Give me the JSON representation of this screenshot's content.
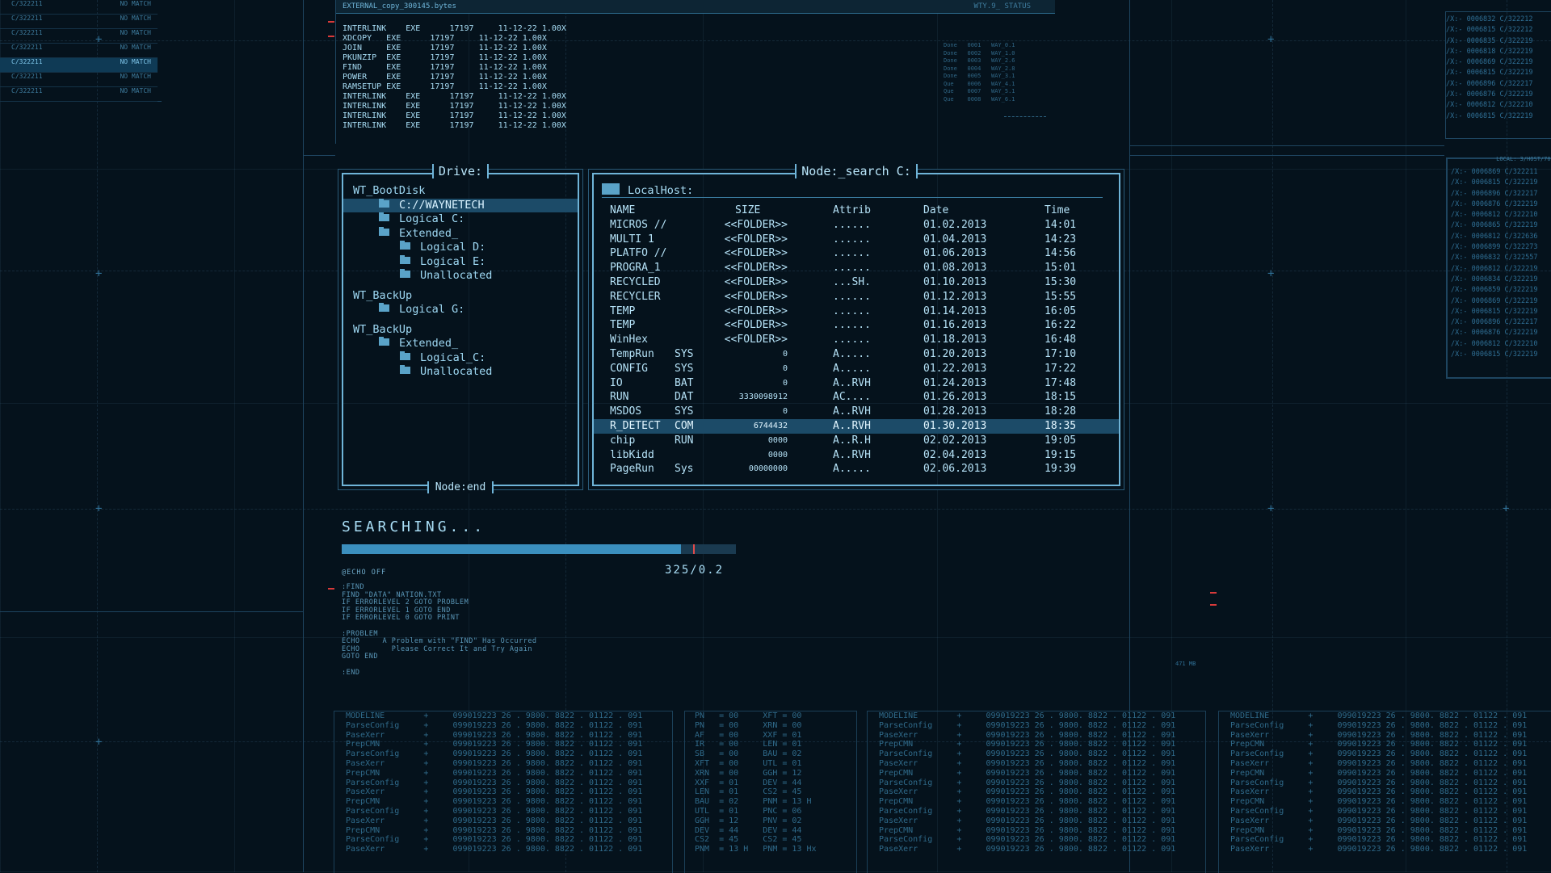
{
  "match_list": [
    {
      "id": "C/322211",
      "status": "NO MATCH"
    },
    {
      "id": "C/322211",
      "status": "NO MATCH"
    },
    {
      "id": "C/322211",
      "status": "NO MATCH"
    },
    {
      "id": "C/322211",
      "status": "NO MATCH"
    },
    {
      "id": "C/322211",
      "status": "NO MATCH",
      "selected": true
    },
    {
      "id": "C/322211",
      "status": "NO MATCH"
    },
    {
      "id": "C/322211",
      "status": "NO MATCH"
    }
  ],
  "top_terminal": {
    "file_label": "EXTERNAL_copy_300145.bytes",
    "status_label": "WTY.9_ STATUS",
    "commands": [
      "INTERLINK    EXE      17197     11-12-22 1.00X",
      "XDCOPY   EXE      17197     11-12-22 1.00X",
      "JOIN     EXE      17197     11-12-22 1.00X",
      "PKUNZIP  EXE      17197     11-12-22 1.00X",
      "FIND     EXE      17197     11-12-22 1.00X",
      "POWER    EXE      17197     11-12-22 1.00X",
      "RAMSETUP EXE      17197     11-12-22 1.00X",
      "INTERLINK    EXE      17197     11-12-22 1.00X",
      "INTERLINK    EXE      17197     11-12-22 1.00X",
      "INTERLINK    EXE      17197     11-12-22 1.00X",
      "INTERLINK    EXE      17197     11-12-22 1.00X"
    ],
    "queue": [
      "Done   0001   WAY_0.1",
      "Done   0002   WAY_1.0",
      "Done   0003   WAY_2.6",
      "Done   0004   WAY_2.8",
      "Done   0005   WAY_3.1",
      "Que    0006   WAY_4.1",
      "Que    0007   WAY_5.1",
      "Que    0008   WAY_6.1"
    ]
  },
  "right_dump": {
    "rows_top": [
      "/X:- 0006832 C/322212",
      "/X:- 0006815 C/322212",
      "/X:- 0006835 C/322219",
      "/X:- 0006818 C/322219",
      "/X:- 0006869 C/322219",
      "/X:- 0006815 C/322219",
      "/X:- 0006896 C/322217",
      "/X:- 0006876 C/322219",
      "/X:- 0006812 C/322210",
      "/X:- 0006815 C/322219"
    ],
    "box2_header": "LOCAL: 3/HOST/7008",
    "rows_bottom": [
      "/X:- 0006869 C/322211",
      "/X:- 0006815 C/322219",
      "/X:- 0006896 C/322217",
      "/X:- 0006876 C/322219",
      "/X:- 0006812 C/322210",
      "/X:- 0006865 C/322219",
      "/X:- 0006812 C/322636",
      "/X:- 0006899 C/322273",
      "/X:- 0006832 C/322557",
      "/X:- 0006812 C/322219",
      "/X:- 0006834 C/322219",
      "/X:- 0006859 C/322219",
      "/X:- 0006869 C/322219",
      "/X:- 0006815 C/322219",
      "/X:- 0006896 C/322217",
      "/X:- 0006876 C/322219",
      "/X:- 0006812 C/322210",
      "/X:- 0006815 C/322219"
    ]
  },
  "drive_panel": {
    "title": "Drive:",
    "footer": "Node:end",
    "tree": [
      {
        "label": "WT_BootDisk",
        "level": 0,
        "folder": false
      },
      {
        "label": "C://WAYNETECH",
        "level": 1,
        "folder": true,
        "selected": true
      },
      {
        "label": "Logical C:",
        "level": 1,
        "folder": true
      },
      {
        "label": "Extended_",
        "level": 1,
        "folder": true
      },
      {
        "label": "Logical D:",
        "level": 2,
        "folder": true
      },
      {
        "label": "Logical E:",
        "level": 2,
        "folder": true
      },
      {
        "label": "Unallocated",
        "level": 2,
        "folder": true
      },
      {
        "label": "",
        "level": 0,
        "folder": false
      },
      {
        "label": "WT_BackUp",
        "level": 0,
        "folder": false
      },
      {
        "label": "Logical G:",
        "level": 1,
        "folder": true
      },
      {
        "label": "",
        "level": 0,
        "folder": false
      },
      {
        "label": "WT_BackUp",
        "level": 0,
        "folder": false
      },
      {
        "label": "Extended_",
        "level": 1,
        "folder": true
      },
      {
        "label": "Logical_C:",
        "level": 2,
        "folder": true
      },
      {
        "label": "Unallocated",
        "level": 2,
        "folder": true
      }
    ]
  },
  "node_panel": {
    "title": "Node:_search C:",
    "location": "LocalHost:",
    "columns": {
      "name": "NAME",
      "size": "SIZE",
      "attrib": "Attrib",
      "date": "Date",
      "time": "Time"
    },
    "rows": [
      {
        "name": "MICROS //",
        "ext": "",
        "size": "<<FOLDER>>",
        "attrib": "......",
        "date": "01.02.2013",
        "time": "14:01"
      },
      {
        "name": "MULTI 1",
        "ext": "",
        "size": "<<FOLDER>>",
        "attrib": "......",
        "date": "01.04.2013",
        "time": "14:23"
      },
      {
        "name": "PLATFO //",
        "ext": "",
        "size": "<<FOLDER>>",
        "attrib": "......",
        "date": "01.06.2013",
        "time": "14:56"
      },
      {
        "name": "PROGRA_1",
        "ext": "",
        "size": "<<FOLDER>>",
        "attrib": "......",
        "date": "01.08.2013",
        "time": "15:01"
      },
      {
        "name": "RECYCLED",
        "ext": "",
        "size": "<<FOLDER>>",
        "attrib": "...SH.",
        "date": "01.10.2013",
        "time": "15:30"
      },
      {
        "name": "RECYCLER",
        "ext": "",
        "size": "<<FOLDER>>",
        "attrib": "......",
        "date": "01.12.2013",
        "time": "15:55"
      },
      {
        "name": "TEMP",
        "ext": "",
        "size": "<<FOLDER>>",
        "attrib": "......",
        "date": "01.14.2013",
        "time": "16:05"
      },
      {
        "name": "TEMP",
        "ext": "",
        "size": "<<FOLDER>>",
        "attrib": "......",
        "date": "01.16.2013",
        "time": "16:22"
      },
      {
        "name": "WinHex",
        "ext": "",
        "size": "<<FOLDER>>",
        "attrib": "......",
        "date": "01.18.2013",
        "time": "16:48"
      },
      {
        "name": "TempRun",
        "ext": "SYS",
        "size": "0",
        "attrib": "A.....",
        "date": "01.20.2013",
        "time": "17:10"
      },
      {
        "name": "CONFIG",
        "ext": "SYS",
        "size": "0",
        "attrib": "A.....",
        "date": "01.22.2013",
        "time": "17:22"
      },
      {
        "name": "IO",
        "ext": "BAT",
        "size": "0",
        "attrib": "A..RVH",
        "date": "01.24.2013",
        "time": "17:48"
      },
      {
        "name": "RUN",
        "ext": "DAT",
        "size": "3330098912",
        "attrib": "AC....",
        "date": "01.26.2013",
        "time": "18:15"
      },
      {
        "name": "MSDOS",
        "ext": "SYS",
        "size": "0",
        "attrib": "A..RVH",
        "date": "01.28.2013",
        "time": "18:28"
      },
      {
        "name": "R_DETECT",
        "ext": "COM",
        "size": "6744432",
        "attrib": "A..RVH",
        "date": "01.30.2013",
        "time": "18:35",
        "selected": true
      },
      {
        "name": "chip",
        "ext": "RUN",
        "size": "0000",
        "attrib": "A..R.H",
        "date": "02.02.2013",
        "time": "19:05"
      },
      {
        "name": "libKidd",
        "ext": "",
        "size": "0000",
        "attrib": "A..RVH",
        "date": "02.04.2013",
        "time": "19:15"
      },
      {
        "name": "PageRun",
        "ext": "Sys",
        "size": "00000000",
        "attrib": "A.....",
        "date": "02.06.2013",
        "time": "19:39"
      }
    ]
  },
  "search": {
    "label": "SEARCHING...",
    "progress": 0.86,
    "progress_text": "325/0.2",
    "echo": "@ECHO OFF",
    "script": [
      ":FIND",
      "FIND \"DATA\" NATION.TXT",
      "IF ERRORLEVEL 2 GOTO PROBLEM",
      "IF ERRORLEVEL 1 GOTO END",
      "IF ERRORLEVEL 0 GOTO PRINT",
      "",
      ":PROBLEM",
      "ECHO     A Problem with \"FIND\" Has Occurred",
      "ECHO       Please Correct It and Try Again",
      "GOTO END",
      "",
      ":END"
    ],
    "mem_label": "471 MB"
  },
  "bottom_boxes": {
    "model_rows": [
      "MODELINE        +     099019223 26 . 9800. 8822 . 01122 . 091",
      "ParseConfig     +     099019223 26 . 9800. 8822 . 01122 . 091",
      "PaseXerr        +     099019223 26 . 9800. 8822 . 01122 . 091",
      "PrepCMN         +     099019223 26 . 9800. 8822 . 01122 . 091",
      "ParseConfig     +     099019223 26 . 9800. 8822 . 01122 . 091",
      "PaseXerr        +     099019223 26 . 9800. 8822 . 01122 . 091",
      "PrepCMN         +     099019223 26 . 9800. 8822 . 01122 . 091",
      "ParseConfig     +     099019223 26 . 9800. 8822 . 01122 . 091",
      "PaseXerr        +     099019223 26 . 9800. 8822 . 01122 . 091",
      "PrepCMN         +     099019223 26 . 9800. 8822 . 01122 . 091",
      "ParseConfig     +     099019223 26 . 9800. 8822 . 01122 . 091",
      "",
      "PaseXerr        +     099019223 26 . 9800. 8822 . 01122 . 091",
      "PrepCMN         +     099019223 26 . 9800. 8822 . 01122 . 091",
      "ParseConfig     +     099019223 26 . 9800. 8822 . 01122 . 091",
      "PaseXerr        +     099019223 26 . 9800. 8822 . 01122 . 091"
    ],
    "reg_rows": [
      "PN   = 00     XFT = 00",
      "PN   = 00     XRN = 00",
      "AF   = 00     XXF = 01",
      "IR   = 00     LEN = 01",
      "SB   = 00     BAU = 02",
      "XFT  = 00     UTL = 01",
      "XRN  = 00     GGH = 12",
      "XXF  = 01     DEV = 44",
      "LEN  = 01     CS2 = 45",
      "BAU  = 02     PNM = 13 H",
      "UTL  = 01     PNC = 06",
      "GGH  = 12     PNV = 02",
      "DEV  = 44     DEV = 44",
      "CS2  = 45     CS2 = 45",
      "PNM  = 13 H   PNM = 13 Hx"
    ]
  }
}
